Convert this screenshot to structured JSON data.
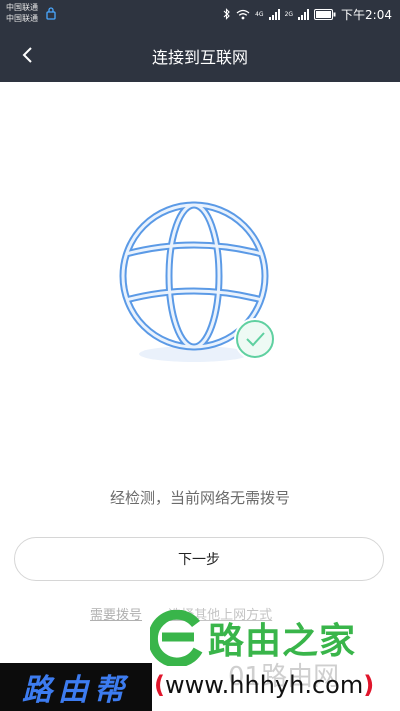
{
  "status_bar": {
    "carrier_1": "中国联通",
    "carrier_2": "中国联通",
    "net_4g": "4G",
    "net_2g": "2G",
    "time": "下午2:04"
  },
  "header": {
    "title": "连接到互联网"
  },
  "main": {
    "status_message": "经检测，当前网络无需拨号",
    "next_button": "下一步",
    "link_dial": "需要拨号",
    "link_other": "选择其他上网方式"
  },
  "watermark": {
    "green_text": "路由之家",
    "faint_text": "01路由网",
    "blue_text": "路由帮",
    "url_open": "(",
    "url": "www.hhhyh.com",
    "url_close": ")"
  },
  "colors": {
    "header_bg": "#2e3440",
    "globe_stroke": "#5b9ae6",
    "check_green": "#5fd0a0"
  }
}
